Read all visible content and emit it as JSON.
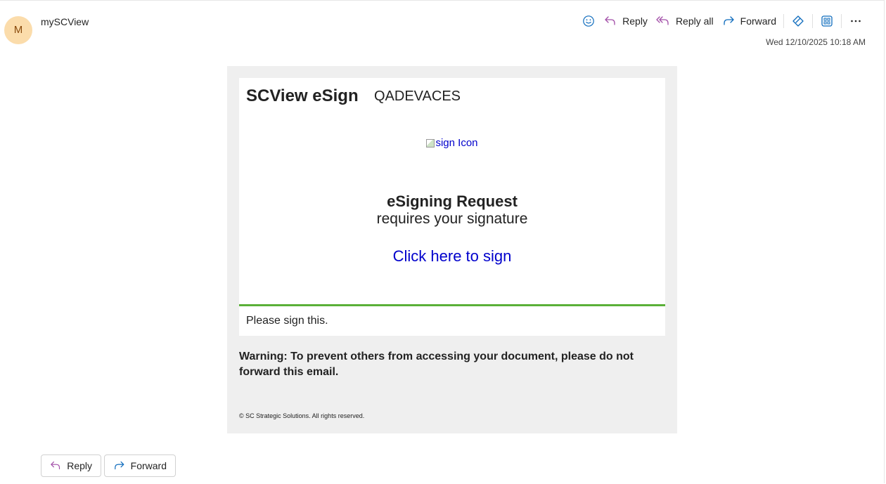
{
  "sender": {
    "avatar_initial": "M",
    "name": "mySCView"
  },
  "toolbar": {
    "reply_label": "Reply",
    "reply_all_label": "Reply all",
    "forward_label": "Forward",
    "icons": [
      "emoji-icon",
      "reply-icon",
      "reply-all-icon",
      "forward-icon",
      "loop-icon",
      "apps-icon",
      "more-icon"
    ]
  },
  "timestamp": "Wed 12/10/2025 10:18 AM",
  "email": {
    "brand": "SCView eSign",
    "tenant": "QADEVACES",
    "image_alt": "sign Icon",
    "request_title": "eSigning Request",
    "request_subtitle": "requires your signature",
    "sign_link": "Click here to sign",
    "note": "Please sign this.",
    "warning": "Warning: To prevent others from accessing your document, please do not forward this email.",
    "copyright": "© SC Strategic Solutions. All rights reserved.",
    "colors": {
      "link": "#0000cc",
      "rule": "#5ab038",
      "outer_background": "#efefef"
    }
  },
  "footer_actions": {
    "reply_label": "Reply",
    "forward_label": "Forward"
  },
  "colors": {
    "avatar_bg": "#fbdcab",
    "accent": "#0f6cbd",
    "reply_icon": "#a24fa8"
  }
}
